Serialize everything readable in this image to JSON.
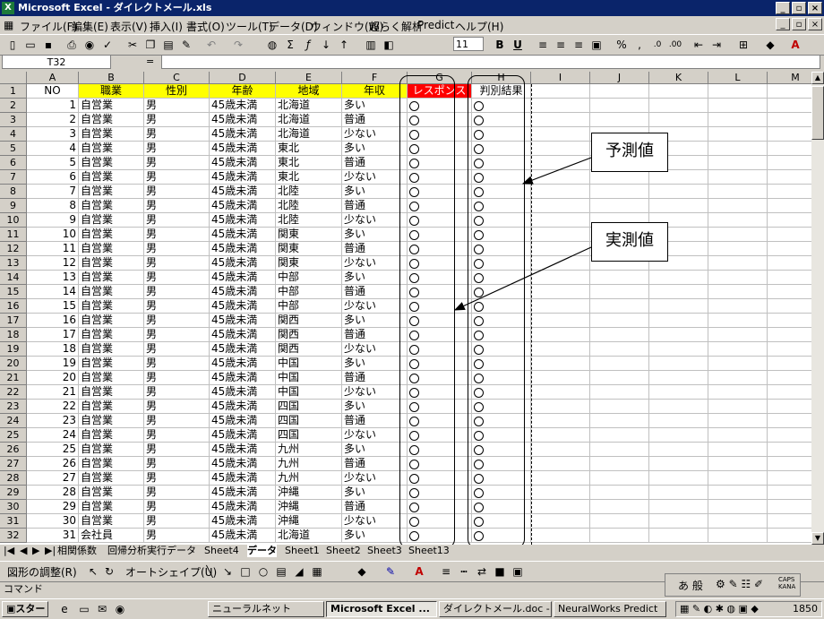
{
  "window": {
    "title": "Microsoft Excel - ダイレクトメール.xls"
  },
  "menu": [
    "ファイル(F)",
    "編集(E)",
    "表示(V)",
    "挿入(I)",
    "書式(O)",
    "ツール(T)",
    "データ(D)",
    "ウィンドウ(W)",
    "超らく解析",
    "Predict",
    "ヘルプ(H)"
  ],
  "toolbar": {
    "font_size": "11",
    "zoom_icon": "Σ"
  },
  "formula": {
    "namebox": "T32",
    "eq": "=",
    "value": ""
  },
  "columns": [
    "A",
    "B",
    "C",
    "D",
    "E",
    "F",
    "G",
    "H",
    "I",
    "J",
    "K",
    "L",
    "M"
  ],
  "header_row": [
    "NO",
    "職業",
    "性別",
    "年齢",
    "地域",
    "年収",
    "レスポンス",
    "判別結果"
  ],
  "rows": [
    {
      "r": "2",
      "no": "1",
      "job": "自営業",
      "sex": "男",
      "age": "45歳未満",
      "area": "北海道",
      "inc": "多い"
    },
    {
      "r": "3",
      "no": "2",
      "job": "自営業",
      "sex": "男",
      "age": "45歳未満",
      "area": "北海道",
      "inc": "普通"
    },
    {
      "r": "4",
      "no": "3",
      "job": "自営業",
      "sex": "男",
      "age": "45歳未満",
      "area": "北海道",
      "inc": "少ない"
    },
    {
      "r": "5",
      "no": "4",
      "job": "自営業",
      "sex": "男",
      "age": "45歳未満",
      "area": "東北",
      "inc": "多い"
    },
    {
      "r": "6",
      "no": "5",
      "job": "自営業",
      "sex": "男",
      "age": "45歳未満",
      "area": "東北",
      "inc": "普通"
    },
    {
      "r": "7",
      "no": "6",
      "job": "自営業",
      "sex": "男",
      "age": "45歳未満",
      "area": "東北",
      "inc": "少ない"
    },
    {
      "r": "8",
      "no": "7",
      "job": "自営業",
      "sex": "男",
      "age": "45歳未満",
      "area": "北陸",
      "inc": "多い"
    },
    {
      "r": "9",
      "no": "8",
      "job": "自営業",
      "sex": "男",
      "age": "45歳未満",
      "area": "北陸",
      "inc": "普通"
    },
    {
      "r": "10",
      "no": "9",
      "job": "自営業",
      "sex": "男",
      "age": "45歳未満",
      "area": "北陸",
      "inc": "少ない"
    },
    {
      "r": "11",
      "no": "10",
      "job": "自営業",
      "sex": "男",
      "age": "45歳未満",
      "area": "関東",
      "inc": "多い"
    },
    {
      "r": "12",
      "no": "11",
      "job": "自営業",
      "sex": "男",
      "age": "45歳未満",
      "area": "関東",
      "inc": "普通"
    },
    {
      "r": "13",
      "no": "12",
      "job": "自営業",
      "sex": "男",
      "age": "45歳未満",
      "area": "関東",
      "inc": "少ない"
    },
    {
      "r": "14",
      "no": "13",
      "job": "自営業",
      "sex": "男",
      "age": "45歳未満",
      "area": "中部",
      "inc": "多い"
    },
    {
      "r": "15",
      "no": "14",
      "job": "自営業",
      "sex": "男",
      "age": "45歳未満",
      "area": "中部",
      "inc": "普通"
    },
    {
      "r": "16",
      "no": "15",
      "job": "自営業",
      "sex": "男",
      "age": "45歳未満",
      "area": "中部",
      "inc": "少ない"
    },
    {
      "r": "17",
      "no": "16",
      "job": "自営業",
      "sex": "男",
      "age": "45歳未満",
      "area": "関西",
      "inc": "多い"
    },
    {
      "r": "18",
      "no": "17",
      "job": "自営業",
      "sex": "男",
      "age": "45歳未満",
      "area": "関西",
      "inc": "普通"
    },
    {
      "r": "19",
      "no": "18",
      "job": "自営業",
      "sex": "男",
      "age": "45歳未満",
      "area": "関西",
      "inc": "少ない"
    },
    {
      "r": "20",
      "no": "19",
      "job": "自営業",
      "sex": "男",
      "age": "45歳未満",
      "area": "中国",
      "inc": "多い"
    },
    {
      "r": "21",
      "no": "20",
      "job": "自営業",
      "sex": "男",
      "age": "45歳未満",
      "area": "中国",
      "inc": "普通"
    },
    {
      "r": "22",
      "no": "21",
      "job": "自営業",
      "sex": "男",
      "age": "45歳未満",
      "area": "中国",
      "inc": "少ない"
    },
    {
      "r": "23",
      "no": "22",
      "job": "自営業",
      "sex": "男",
      "age": "45歳未満",
      "area": "四国",
      "inc": "多い"
    },
    {
      "r": "24",
      "no": "23",
      "job": "自営業",
      "sex": "男",
      "age": "45歳未満",
      "area": "四国",
      "inc": "普通"
    },
    {
      "r": "25",
      "no": "24",
      "job": "自営業",
      "sex": "男",
      "age": "45歳未満",
      "area": "四国",
      "inc": "少ない"
    },
    {
      "r": "26",
      "no": "25",
      "job": "自営業",
      "sex": "男",
      "age": "45歳未満",
      "area": "九州",
      "inc": "多い"
    },
    {
      "r": "27",
      "no": "26",
      "job": "自営業",
      "sex": "男",
      "age": "45歳未満",
      "area": "九州",
      "inc": "普通"
    },
    {
      "r": "28",
      "no": "27",
      "job": "自営業",
      "sex": "男",
      "age": "45歳未満",
      "area": "九州",
      "inc": "少ない"
    },
    {
      "r": "29",
      "no": "28",
      "job": "自営業",
      "sex": "男",
      "age": "45歳未満",
      "area": "沖縄",
      "inc": "多い"
    },
    {
      "r": "30",
      "no": "29",
      "job": "自営業",
      "sex": "男",
      "age": "45歳未満",
      "area": "沖縄",
      "inc": "普通"
    },
    {
      "r": "31",
      "no": "30",
      "job": "自営業",
      "sex": "男",
      "age": "45歳未満",
      "area": "沖縄",
      "inc": "少ない"
    },
    {
      "r": "32",
      "no": "31",
      "job": "会社員",
      "sex": "男",
      "age": "45歳未満",
      "area": "北海道",
      "inc": "多い"
    }
  ],
  "callouts": {
    "predicted": "予測値",
    "actual": "実測値"
  },
  "sheet_tabs": [
    "相関係数",
    "回帰分析実行データ",
    "Sheet4",
    "データ",
    "Sheet1",
    "Sheet2",
    "Sheet3",
    "Sheet13"
  ],
  "active_tab": "データ",
  "drawbar": {
    "draw": "図形の調整(R)",
    "autoshape": "オートシェイプ(U)"
  },
  "status": {
    "mode": "コマンド"
  },
  "ime": {
    "label": "あ 般"
  },
  "taskbar": {
    "start": "スタート",
    "tasks": [
      "ニューラルネット",
      "Microsoft Excel ...",
      "ダイレクトメール.doc - ...",
      "NeuralWorks Predict"
    ],
    "clock": "1850"
  },
  "colors": {
    "header_fill": "#ffff00",
    "response_fill": "#ff0000",
    "title_bg": "#0a246a"
  }
}
